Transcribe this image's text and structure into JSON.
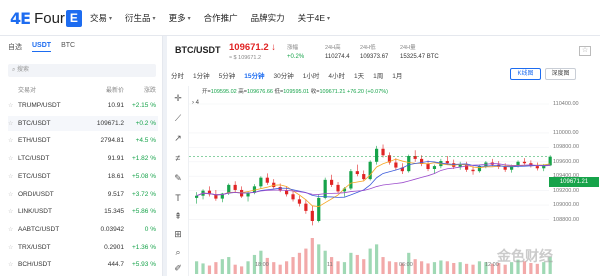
{
  "brand": {
    "mark": "4E",
    "text": "Four",
    "badge": "E"
  },
  "nav": [
    {
      "label": "交易",
      "caret": true
    },
    {
      "label": "衍生品",
      "caret": true
    },
    {
      "label": "更多",
      "caret": true
    },
    {
      "label": "合作推广",
      "caret": false
    },
    {
      "label": "品牌实力",
      "caret": false
    },
    {
      "label": "关于4E",
      "caret": true
    }
  ],
  "market": {
    "tabs": [
      "自选",
      "USDT",
      "BTC"
    ],
    "active_tab": "USDT",
    "search_placeholder": "搜索",
    "headers": {
      "pair": "交易对",
      "price": "最新价",
      "change": "涨跌"
    },
    "rows": [
      {
        "pair": "TRUMP/USDT",
        "price": "10.91",
        "change": "+2.15 %"
      },
      {
        "pair": "BTC/USDT",
        "price": "109671.2",
        "change": "+0.2 %"
      },
      {
        "pair": "ETH/USDT",
        "price": "2794.81",
        "change": "+4.5 %"
      },
      {
        "pair": "LTC/USDT",
        "price": "91.91",
        "change": "+1.82 %"
      },
      {
        "pair": "ETC/USDT",
        "price": "18.61",
        "change": "+5.08 %"
      },
      {
        "pair": "ORDI/USDT",
        "price": "9.517",
        "change": "+3.72 %"
      },
      {
        "pair": "LINK/USDT",
        "price": "15.345",
        "price_note": "",
        "change": "+5.86 %"
      },
      {
        "pair": "AABTC/USDT",
        "price": "0.03942",
        "change": "0 %"
      },
      {
        "pair": "TRX/USDT",
        "price": "0.2901",
        "change": "+1.36 %"
      },
      {
        "pair": "BCH/USDT",
        "price": "444.7",
        "change": "+5.93 %"
      }
    ]
  },
  "ticker": {
    "pair": "BTC/USDT",
    "price": "109671.2",
    "arrow": "↓",
    "sub": "≈ $ 109671.2",
    "stats": [
      {
        "label": "涨幅",
        "value": "+0.2%"
      },
      {
        "label": "24H高",
        "value": "110274.4"
      },
      {
        "label": "24H低",
        "value": "109373.67"
      },
      {
        "label": "24H量",
        "value": "15325.47 BTC"
      }
    ]
  },
  "timeframes": [
    "分时",
    "1分钟",
    "5分钟",
    "15分钟",
    "30分钟",
    "1小时",
    "4小时",
    "1天",
    "1周",
    "1月"
  ],
  "active_timeframe": "15分钟",
  "view_buttons": {
    "kline": "K线图",
    "depth": "深度图"
  },
  "ohlc": {
    "open_label": "开=",
    "open": "109595.02",
    "high_label": "高=",
    "high": "109676.66",
    "low_label": "低=",
    "low": "109595.01",
    "close_label": "收=",
    "close": "109671.21",
    "change": "+76.20",
    "change_pct": "(+0.07%)"
  },
  "ma_toggle": "4",
  "current_price_label": "109671.21",
  "watermark": "金色财经",
  "chart_data": {
    "type": "candlestick",
    "y_axis": {
      "min": 108600,
      "max": 110400,
      "ticks": [
        110400,
        110000,
        109800,
        109600,
        109400,
        109200,
        109000,
        108800
      ]
    },
    "x_axis": {
      "ticks": [
        "18:00",
        "11",
        "06:00",
        "12:00"
      ]
    },
    "candles": [
      [
        109100,
        109180,
        109020,
        109130
      ],
      [
        109130,
        109220,
        109080,
        109200
      ],
      [
        109200,
        109260,
        109120,
        109150
      ],
      [
        109150,
        109210,
        109060,
        109090
      ],
      [
        109090,
        109170,
        109040,
        109160
      ],
      [
        109160,
        109300,
        109140,
        109280
      ],
      [
        109280,
        109330,
        109180,
        109210
      ],
      [
        109210,
        109260,
        109100,
        109120
      ],
      [
        109120,
        109190,
        109050,
        109170
      ],
      [
        109170,
        109290,
        109150,
        109260
      ],
      [
        109260,
        109400,
        109230,
        109380
      ],
      [
        109380,
        109440,
        109280,
        109310
      ],
      [
        109310,
        109360,
        109230,
        109250
      ],
      [
        109250,
        109300,
        109180,
        109200
      ],
      [
        109200,
        109260,
        109120,
        109150
      ],
      [
        109150,
        109200,
        109050,
        109080
      ],
      [
        109080,
        109130,
        108980,
        109020
      ],
      [
        109020,
        109080,
        108880,
        108920
      ],
      [
        108920,
        108990,
        108720,
        108780
      ],
      [
        108780,
        109150,
        108760,
        109100
      ],
      [
        109100,
        109380,
        109080,
        109350
      ],
      [
        109350,
        109420,
        109250,
        109280
      ],
      [
        109280,
        109320,
        109160,
        109190
      ],
      [
        109190,
        109250,
        109120,
        109230
      ],
      [
        109230,
        109500,
        109210,
        109470
      ],
      [
        109470,
        109560,
        109400,
        109430
      ],
      [
        109430,
        109480,
        109330,
        109360
      ],
      [
        109360,
        109620,
        109340,
        109600
      ],
      [
        109600,
        109820,
        109560,
        109780
      ],
      [
        109780,
        109840,
        109660,
        109690
      ],
      [
        109690,
        109730,
        109560,
        109590
      ],
      [
        109590,
        109650,
        109480,
        109520
      ],
      [
        109520,
        109580,
        109430,
        109470
      ],
      [
        109470,
        109700,
        109450,
        109680
      ],
      [
        109680,
        109760,
        109600,
        109640
      ],
      [
        109640,
        109690,
        109540,
        109570
      ],
      [
        109570,
        109620,
        109470,
        109500
      ],
      [
        109500,
        109560,
        109430,
        109540
      ],
      [
        109540,
        109640,
        109510,
        109610
      ],
      [
        109610,
        109680,
        109560,
        109580
      ],
      [
        109580,
        109630,
        109500,
        109530
      ],
      [
        109530,
        109600,
        109490,
        109560
      ],
      [
        109560,
        109600,
        109460,
        109490
      ],
      [
        109490,
        109540,
        109420,
        109470
      ],
      [
        109470,
        109560,
        109450,
        109540
      ],
      [
        109540,
        109610,
        109510,
        109590
      ],
      [
        109590,
        109640,
        109540,
        109560
      ],
      [
        109560,
        109610,
        109500,
        109530
      ],
      [
        109530,
        109580,
        109460,
        109490
      ],
      [
        109490,
        109560,
        109450,
        109540
      ],
      [
        109540,
        109620,
        109520,
        109600
      ],
      [
        109600,
        109650,
        109560,
        109580
      ],
      [
        109580,
        109620,
        109520,
        109540
      ],
      [
        109540,
        109590,
        109480,
        109510
      ],
      [
        109510,
        109570,
        109470,
        109550
      ],
      [
        109550,
        109690,
        109540,
        109671
      ]
    ],
    "ma_lines": [
      {
        "name": "MA-orange",
        "color": "#f5a623"
      },
      {
        "name": "MA-blue",
        "color": "#3b5bdb"
      },
      {
        "name": "MA-purple",
        "color": "#9c4dcc"
      }
    ],
    "volume": [
      30,
      25,
      20,
      28,
      35,
      40,
      22,
      18,
      30,
      45,
      55,
      38,
      28,
      22,
      30,
      40,
      50,
      60,
      85,
      70,
      55,
      40,
      30,
      28,
      50,
      45,
      35,
      60,
      70,
      40,
      30,
      28,
      25,
      50,
      35,
      30,
      25,
      28,
      32,
      30,
      26,
      28,
      24,
      22,
      30,
      28,
      24,
      26,
      22,
      28,
      34,
      30,
      26,
      24,
      28,
      40
    ]
  }
}
